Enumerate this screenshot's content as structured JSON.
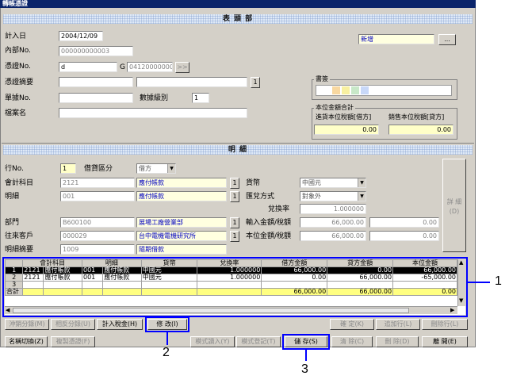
{
  "window": {
    "title": "轉帳憑證"
  },
  "header_section": {
    "banner": "表 頭 部"
  },
  "form": {
    "entry_date_label": "計入日",
    "entry_date": "2004/12/09",
    "internal_no_label": "內部No.",
    "internal_no": "000000000003",
    "voucher_no_label": "憑證No.",
    "voucher_no": "d",
    "voucher_g": "G",
    "voucher_code": "041200000003",
    "voucher_btn": ">>",
    "summary_label": "憑證摘要",
    "summary_btn": "1",
    "doc_no_label": "單據No.",
    "count_label": "數據級別",
    "count_value": "1",
    "file_label": "檔案名"
  },
  "status": {
    "value": "新增",
    "btn": "..."
  },
  "books": {
    "title": "書簽"
  },
  "totals": {
    "title": "本位金額合計",
    "in_tax_label": "進貨本位稅額[借方]",
    "in_tax": "0.00",
    "out_tax_label": "銷售本位稅額[貸方]",
    "out_tax": "0.00"
  },
  "detail_section": {
    "banner": "明 細"
  },
  "detail": {
    "row_no_label": "行No.",
    "row_no": "1",
    "dc_label": "借貸區分",
    "dc_value": "借方",
    "account_label": "會計科目",
    "account_code": "2121",
    "account_name": "應付帳款",
    "sub_label": "明細",
    "sub_code": "001",
    "sub_name": "應付帳款",
    "dept_label": "部門",
    "dept_code": "B600100",
    "dept_name": "展場工廠營業部",
    "partner_label": "往來客戶",
    "partner_code": "000029",
    "partner_name": "台中電機電機研究所",
    "memo_label": "明細摘要",
    "memo_code": "1009",
    "memo_name": "隨期借款",
    "currency_label": "貨幣",
    "currency": "中國元",
    "rate_type_label": "匯兌方式",
    "rate_type": "對象外",
    "rate_label": "兌換率",
    "rate": "1.000000",
    "in_amt_label": "輸入金額/稅額",
    "in_amt": "66,000.00",
    "in_tax": "0.00",
    "base_amt_label": "本位金額/稅額",
    "base_amt": "66,000.00",
    "base_tax": "0.00",
    "detail_btn": "詳 細 (D)",
    "one": "1"
  },
  "grid": {
    "headers": [
      "",
      "會計科目",
      "明細",
      "貨幣",
      "兌換率",
      "借方金額",
      "貸方金額",
      "本位金額"
    ],
    "rows": [
      {
        "no": "1",
        "acct_code": "2121",
        "acct": "應付帳款",
        "sub_code": "001",
        "sub": "應付帳款",
        "cur": "中國元",
        "rate": "1.000000",
        "debit": "66,000.00",
        "credit": "0.00",
        "base": "66,000.00"
      },
      {
        "no": "2",
        "acct_code": "2121",
        "acct": "應付帳款",
        "sub_code": "001",
        "sub": "應付帳款",
        "cur": "中國元",
        "rate": "1.000000",
        "debit": "0.00",
        "credit": "66,000.00",
        "base": "-65,000.00"
      },
      {
        "no": "3",
        "acct_code": "",
        "acct": "",
        "sub_code": "",
        "sub": "",
        "cur": "",
        "rate": "",
        "debit": "",
        "credit": "",
        "base": ""
      }
    ],
    "sum_label": "合計",
    "sum_debit": "66,000.00",
    "sum_credit": "66,000.00",
    "sum_base": "0.00"
  },
  "buttons_row1": [
    "沖銷分錄(M)",
    "相反分錄(U)",
    "計入稅金(H)",
    "修 改(I)",
    "確 定(K)",
    "追加行(L)",
    "刪除行(L)"
  ],
  "buttons_row2": [
    "名稱切換(Z)",
    "複製憑證(F)",
    "模式讀入(Y)",
    "模式登記(T)",
    "儲 存(S)",
    "清 除(C)",
    "刪 除(D)",
    "離 開(E)"
  ],
  "callouts": [
    "1",
    "2",
    "3"
  ],
  "colors": {
    "callout": "#0000ff",
    "title_bar": "#0a246a"
  }
}
